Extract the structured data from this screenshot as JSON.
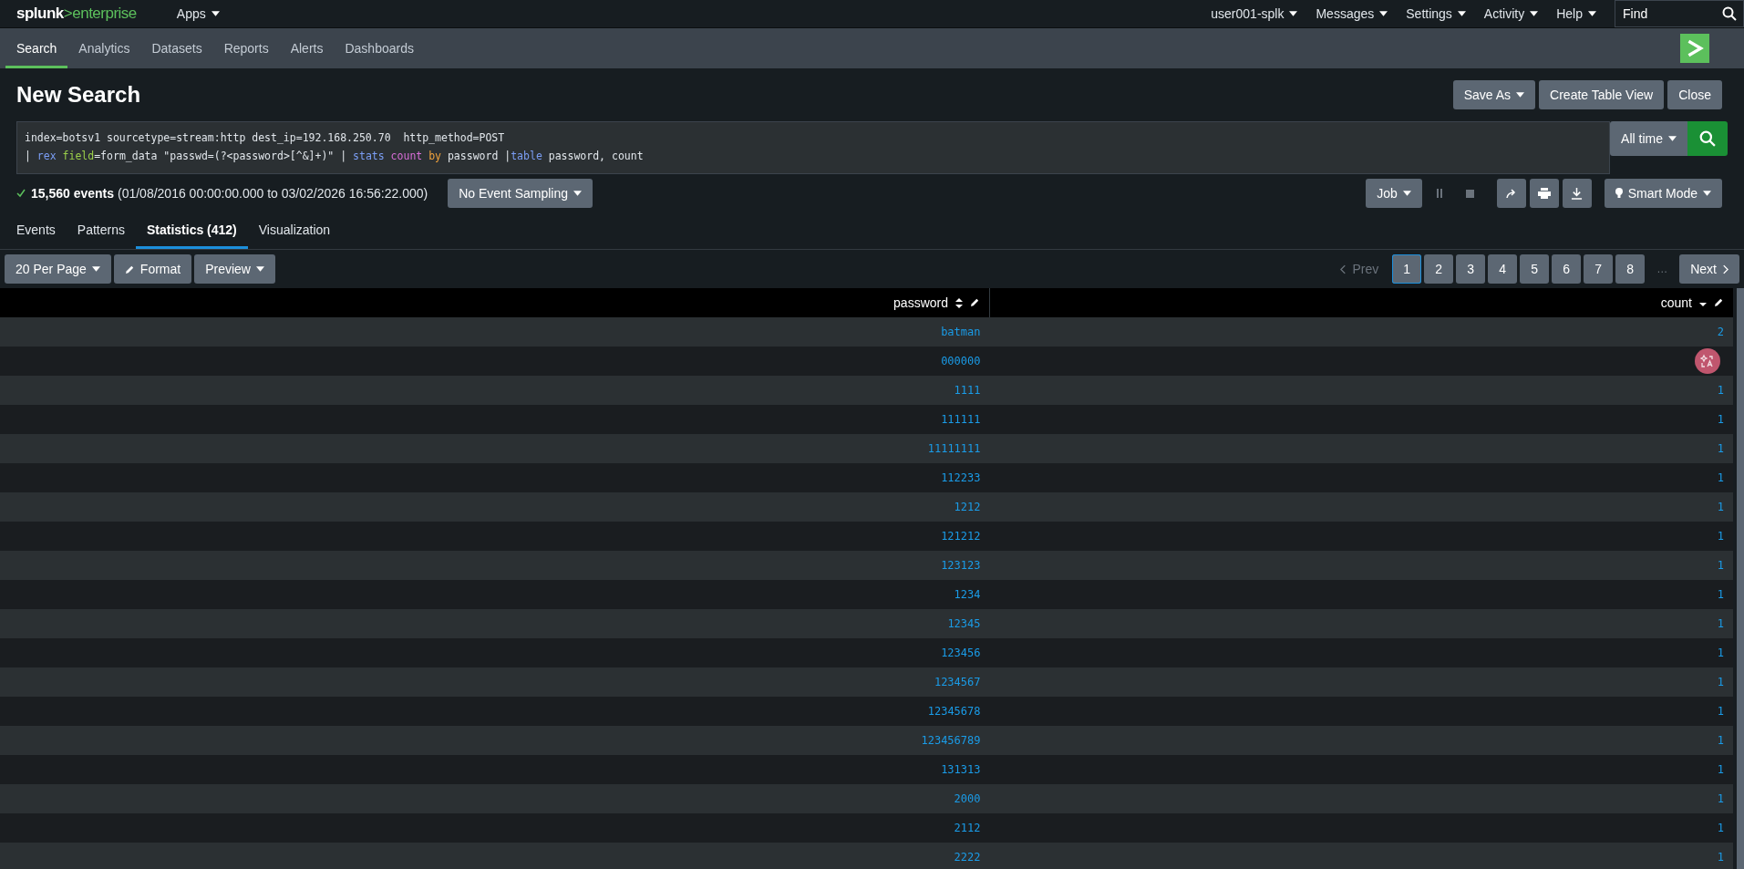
{
  "top_bar": {
    "logo": {
      "primary": "splunk",
      "accent": ">enterprise"
    },
    "apps_menu": "Apps",
    "menus": [
      "user001-splk",
      "Messages",
      "Settings",
      "Activity",
      "Help"
    ],
    "find": {
      "placeholder": "Find"
    }
  },
  "nav": {
    "tabs": [
      {
        "label": "Search",
        "selected": true
      },
      {
        "label": "Analytics",
        "selected": false
      },
      {
        "label": "Datasets",
        "selected": false
      },
      {
        "label": "Reports",
        "selected": false
      },
      {
        "label": "Alerts",
        "selected": false
      },
      {
        "label": "Dashboards",
        "selected": false
      }
    ]
  },
  "page_title": "New Search",
  "header_buttons": [
    {
      "label": "Save As",
      "dropdown": true
    },
    {
      "label": "Create Table View",
      "dropdown": false
    },
    {
      "label": "Close",
      "dropdown": false
    }
  ],
  "search": {
    "query_lines": [
      [
        {
          "text": "index=botsv1 sourcetype=stream:http dest_ip=192.168.250.70  http_method=POST",
          "kind": "plain"
        }
      ],
      [
        {
          "text": "| ",
          "kind": "plain"
        },
        {
          "text": "rex",
          "kind": "command"
        },
        {
          "text": " field",
          "kind": "argument"
        },
        {
          "text": "=form_data \"passwd=(?<password>[^&]+)\" | ",
          "kind": "plain"
        },
        {
          "text": "stats",
          "kind": "command"
        },
        {
          "text": " count",
          "kind": "function"
        },
        {
          "text": " by",
          "kind": "keyword"
        },
        {
          "text": " password |",
          "kind": "plain"
        },
        {
          "text": "table",
          "kind": "command"
        },
        {
          "text": " password, count",
          "kind": "plain"
        }
      ]
    ],
    "time_range": "All time"
  },
  "status": {
    "complete": true,
    "count": "15,560 events",
    "range": "(01/08/2016 00:00:00.000 to 03/02/2026 16:56:22.000)",
    "sampling": "No Event Sampling"
  },
  "job": {
    "label": "Job",
    "mode": "Smart Mode"
  },
  "result_tabs": [
    {
      "label": "Events",
      "selected": false
    },
    {
      "label": "Patterns",
      "selected": false
    },
    {
      "label": "Statistics (412)",
      "selected": true
    },
    {
      "label": "Visualization",
      "selected": false
    }
  ],
  "table_toolbar": {
    "per_page": "20 Per Page",
    "format": "Format",
    "preview": "Preview"
  },
  "pagination": {
    "prev": {
      "label": "Prev",
      "disabled": true
    },
    "pages": [
      {
        "label": "1",
        "selected": true
      },
      {
        "label": "2",
        "selected": false
      },
      {
        "label": "3",
        "selected": false
      },
      {
        "label": "4",
        "selected": false
      },
      {
        "label": "5",
        "selected": false
      },
      {
        "label": "6",
        "selected": false
      },
      {
        "label": "7",
        "selected": false
      },
      {
        "label": "8",
        "selected": false
      }
    ],
    "ellipsis": "…",
    "next": "Next"
  },
  "table": {
    "columns": [
      {
        "label": "password",
        "sorted": false
      },
      {
        "label": "count",
        "sorted": true
      }
    ],
    "rows": [
      {
        "password": "batman",
        "count": "2"
      },
      {
        "password": "000000"
      },
      {
        "password": "1111",
        "count": "1"
      },
      {
        "password": "111111",
        "count": "1"
      },
      {
        "password": "11111111",
        "count": "1"
      },
      {
        "password": "112233",
        "count": "1"
      },
      {
        "password": "1212",
        "count": "1"
      },
      {
        "password": "121212",
        "count": "1"
      },
      {
        "password": "123123",
        "count": "1"
      },
      {
        "password": "1234",
        "count": "1"
      },
      {
        "password": "12345",
        "count": "1"
      },
      {
        "password": "123456",
        "count": "1"
      },
      {
        "password": "1234567",
        "count": "1"
      },
      {
        "password": "12345678",
        "count": "1"
      },
      {
        "password": "123456789",
        "count": "1"
      },
      {
        "password": "131313",
        "count": "1"
      },
      {
        "password": "2000",
        "count": "1"
      },
      {
        "password": "2112",
        "count": "1"
      },
      {
        "password": "2222",
        "count": "1"
      }
    ]
  }
}
